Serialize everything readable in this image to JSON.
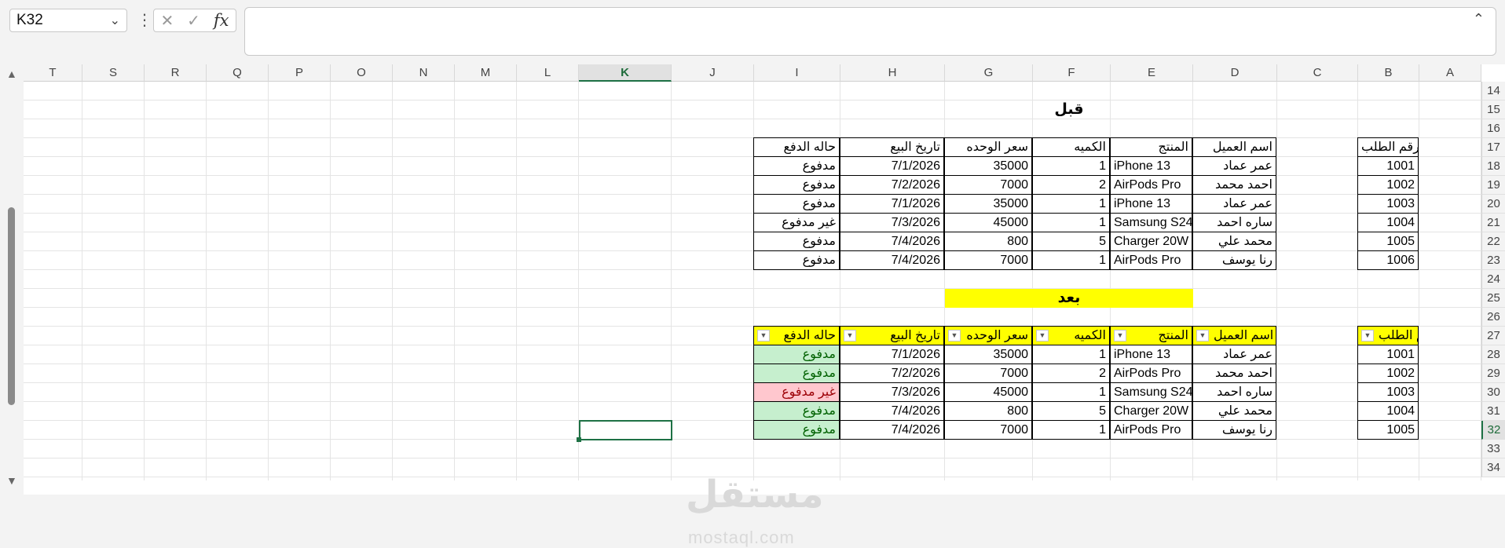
{
  "formula_bar": {
    "name_box": "K32",
    "cancel_symbol": "✕",
    "confirm_symbol": "✓",
    "fx_label": "fx",
    "formula": ""
  },
  "columns": [
    "T",
    "S",
    "R",
    "Q",
    "P",
    "O",
    "N",
    "M",
    "L",
    "K",
    "J",
    "I",
    "H",
    "G",
    "F",
    "E",
    "D",
    "C",
    "B",
    "A"
  ],
  "active_column": "K",
  "rows": [
    "14",
    "15",
    "16",
    "17",
    "18",
    "19",
    "20",
    "21",
    "22",
    "23",
    "24",
    "25",
    "26",
    "27",
    "28",
    "29",
    "30",
    "31",
    "32",
    "33",
    "34"
  ],
  "active_row": "32",
  "before": {
    "title": "قبل",
    "headers": [
      "رقم الطلب",
      "اسم العميل",
      "المنتج",
      "الكميه",
      "سعر الوحده",
      "تاريخ البيع",
      "حاله الدفع"
    ],
    "rows": [
      [
        "1001",
        "عمر عماد",
        "iPhone 13",
        "1",
        "35000",
        "7/1/2026",
        "مدفوع"
      ],
      [
        "1002",
        "احمد محمد",
        "AirPods Pro",
        "2",
        "7000",
        "7/2/2026",
        "مدفوع"
      ],
      [
        "1003",
        "عمر عماد",
        "iPhone 13",
        "1",
        "35000",
        "7/1/2026",
        "مدفوع"
      ],
      [
        "1004",
        "ساره احمد",
        "Samsung S24",
        "1",
        "45000",
        "7/3/2026",
        "غير مدفوع"
      ],
      [
        "1005",
        "محمد علي",
        "Charger 20W",
        "5",
        "800",
        "7/4/2026",
        "مدفوع"
      ],
      [
        "1006",
        "رنا يوسف",
        "AirPods Pro",
        "1",
        "7000",
        "7/4/2026",
        "مدفوع"
      ]
    ]
  },
  "after": {
    "title": "بعد",
    "headers": [
      "رقم الطلب",
      "اسم العميل",
      "المنتج",
      "الكميه",
      "سعر الوحده",
      "تاريخ البيع",
      "حاله الدفع"
    ],
    "dropdown_glyph": "▼",
    "rows": [
      [
        "1001",
        "عمر عماد",
        "iPhone 13",
        "1",
        "35000",
        "7/1/2026",
        "مدفوع"
      ],
      [
        "1002",
        "احمد محمد",
        "AirPods Pro",
        "2",
        "7000",
        "7/2/2026",
        "مدفوع"
      ],
      [
        "1003",
        "ساره احمد",
        "Samsung S24",
        "1",
        "45000",
        "7/3/2026",
        "غير مدفوع"
      ],
      [
        "1004",
        "محمد علي",
        "Charger 20W",
        "5",
        "800",
        "7/4/2026",
        "مدفوع"
      ],
      [
        "1005",
        "رنا يوسف",
        "AirPods Pro",
        "1",
        "7000",
        "7/4/2026",
        "مدفوع"
      ]
    ],
    "status_colors": {
      "paid_bg": "#c6efce",
      "paid_fg": "#006100",
      "unpaid_bg": "#ffc7ce",
      "unpaid_fg": "#9c0006"
    }
  },
  "watermark": {
    "arabic": "مستقل",
    "latin": "mostaql.com"
  },
  "colors": {
    "accent": "#1e7145",
    "highlight": "#ffff00"
  }
}
